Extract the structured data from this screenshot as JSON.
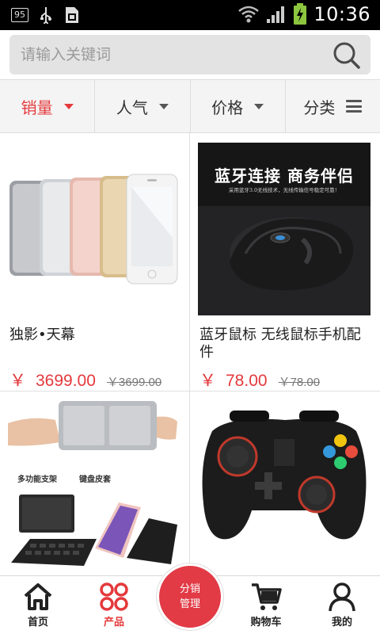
{
  "status_bar": {
    "badge": "95",
    "time": "10:36",
    "icons": [
      "usb-icon",
      "sim-icon",
      "wifi-icon",
      "signal-icon",
      "battery-charging-icon"
    ]
  },
  "search": {
    "placeholder": "请输入关键词"
  },
  "filters": [
    {
      "label": "销量",
      "active": true
    },
    {
      "label": "人气",
      "active": false
    },
    {
      "label": "价格",
      "active": false
    },
    {
      "label": "分类",
      "active": false
    }
  ],
  "products": [
    {
      "name": "独影•天幕",
      "currency": "￥",
      "price": "3699.00",
      "old_price": "￥3699.00"
    },
    {
      "name": "蓝牙鼠标 无线鼠标手机配件",
      "currency": "￥",
      "price": "78.00",
      "old_price": "￥78.00",
      "image_text": {
        "headline": "蓝牙连接 商务伴侣",
        "sub": "采用蓝牙3.0无线技术，无线传输信号稳定可靠！"
      }
    },
    {
      "name": "",
      "image_text": {
        "tag1": "多功能支架",
        "tag2": "键盘皮套"
      }
    },
    {
      "name": ""
    }
  ],
  "bottom_nav": {
    "home": "首页",
    "products": "产品",
    "center_line1": "分销",
    "center_line2": "管理",
    "cart": "购物车",
    "mine": "我的"
  },
  "colors": {
    "accent": "#e4393c",
    "center_button": "#e23b46"
  }
}
